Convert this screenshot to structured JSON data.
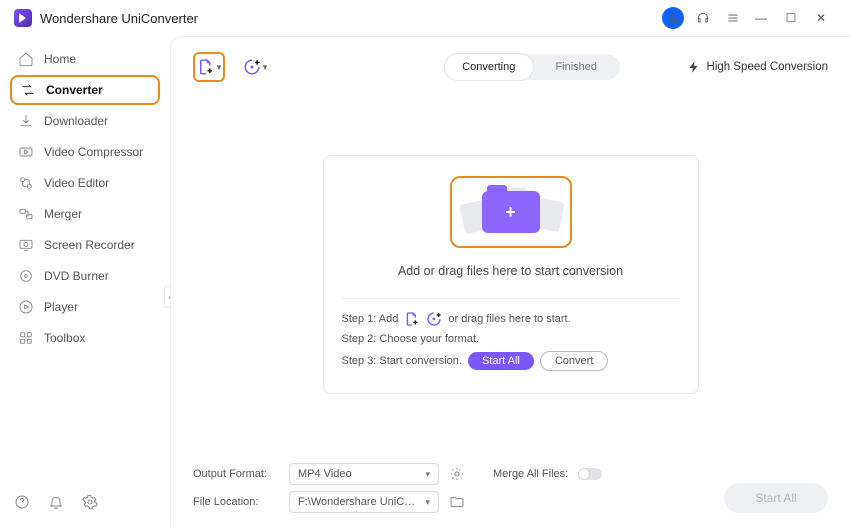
{
  "app": {
    "title": "Wondershare UniConverter"
  },
  "sidebar": {
    "items": [
      {
        "label": "Home"
      },
      {
        "label": "Converter"
      },
      {
        "label": "Downloader"
      },
      {
        "label": "Video Compressor"
      },
      {
        "label": "Video Editor"
      },
      {
        "label": "Merger"
      },
      {
        "label": "Screen Recorder"
      },
      {
        "label": "DVD Burner"
      },
      {
        "label": "Player"
      },
      {
        "label": "Toolbox"
      }
    ]
  },
  "tabs": {
    "converting": "Converting",
    "finished": "Finished"
  },
  "high_speed": "High Speed Conversion",
  "drop": {
    "title": "Add or drag files here to start conversion"
  },
  "steps": {
    "s1a": "Step 1: Add",
    "s1b": "or drag files here to start.",
    "s2": "Step 2: Choose your format.",
    "s3": "Step 3: Start conversion.",
    "start_all": "Start All",
    "convert": "Convert"
  },
  "footer": {
    "output_label": "Output Format:",
    "output_value": "MP4 Video",
    "merge_label": "Merge All Files:",
    "location_label": "File Location:",
    "location_value": "F:\\Wondershare UniConverter",
    "start_all": "Start All"
  }
}
